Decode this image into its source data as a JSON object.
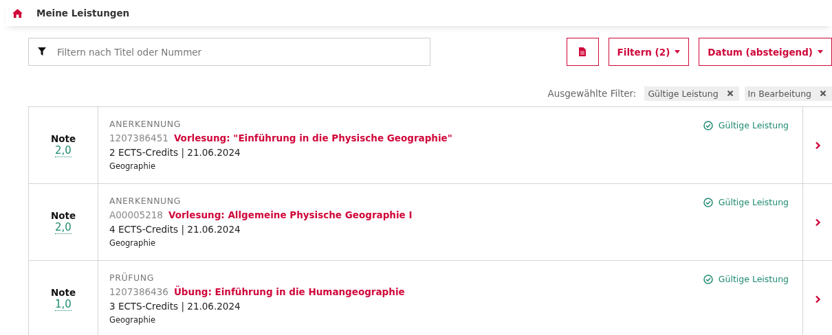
{
  "header": {
    "title": "Meine Leistungen"
  },
  "search": {
    "placeholder": "Filtern nach Titel oder Nummer"
  },
  "buttons": {
    "filter": "Filtern (2)",
    "sort": "Datum (absteigend)"
  },
  "selected_filters": {
    "label": "Ausgewählte Filter:",
    "tags": [
      "Gültige Leistung",
      "In Bearbeitung"
    ]
  },
  "records": [
    {
      "grade_label": "Note",
      "grade": "2,0",
      "type": "ANERKENNUNG",
      "number": "1207386451",
      "title": "Vorlesung: \"Einführung in die Physische Geographie\"",
      "credits": "2 ECTS-Credits | 21.06.2024",
      "subject": "Geographie",
      "status": "Gültige Leistung"
    },
    {
      "grade_label": "Note",
      "grade": "2,0",
      "type": "ANERKENNUNG",
      "number": "A00005218",
      "title": "Vorlesung: Allgemeine Physische Geographie I",
      "credits": "4 ECTS-Credits | 21.06.2024",
      "subject": "Geographie",
      "status": "Gültige Leistung"
    },
    {
      "grade_label": "Note",
      "grade": "1,0",
      "type": "PRÜFUNG",
      "number": "1207386436",
      "title": "Übung: Einführung in die Humangeographie",
      "credits": "3 ECTS-Credits | 21.06.2024",
      "subject": "Geographie",
      "status": "Gültige Leistung"
    }
  ]
}
